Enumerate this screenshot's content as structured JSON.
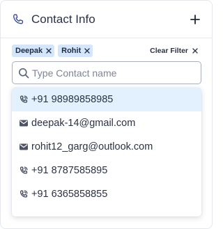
{
  "header": {
    "title": "Contact Info",
    "icon": "phone-icon",
    "add_icon": "plus-icon"
  },
  "filters": {
    "chips": [
      {
        "label": "Deepak"
      },
      {
        "label": "Rohit"
      }
    ],
    "clear_label": "Clear Filter"
  },
  "search": {
    "placeholder": "Type Contact name",
    "value": ""
  },
  "dropdown": {
    "items": [
      {
        "type": "phone",
        "icon": "phone-icon",
        "text": "+91 98989858985",
        "highlighted": true
      },
      {
        "type": "email",
        "icon": "mail-icon",
        "text": "deepak-14@gmail.com",
        "highlighted": false
      },
      {
        "type": "email",
        "icon": "mail-icon",
        "text": "rohit12_garg@outlook.com",
        "highlighted": false
      },
      {
        "type": "phone",
        "icon": "phone-icon",
        "text": "+91 8787585895",
        "highlighted": false
      },
      {
        "type": "phone",
        "icon": "phone-icon",
        "text": "+91 6365858855",
        "highlighted": false
      }
    ]
  },
  "colors": {
    "accent": "#3d4f9f",
    "chip_bg": "#d4e6fb",
    "highlight_bg": "#e2f1fd",
    "text": "#2b3244"
  }
}
